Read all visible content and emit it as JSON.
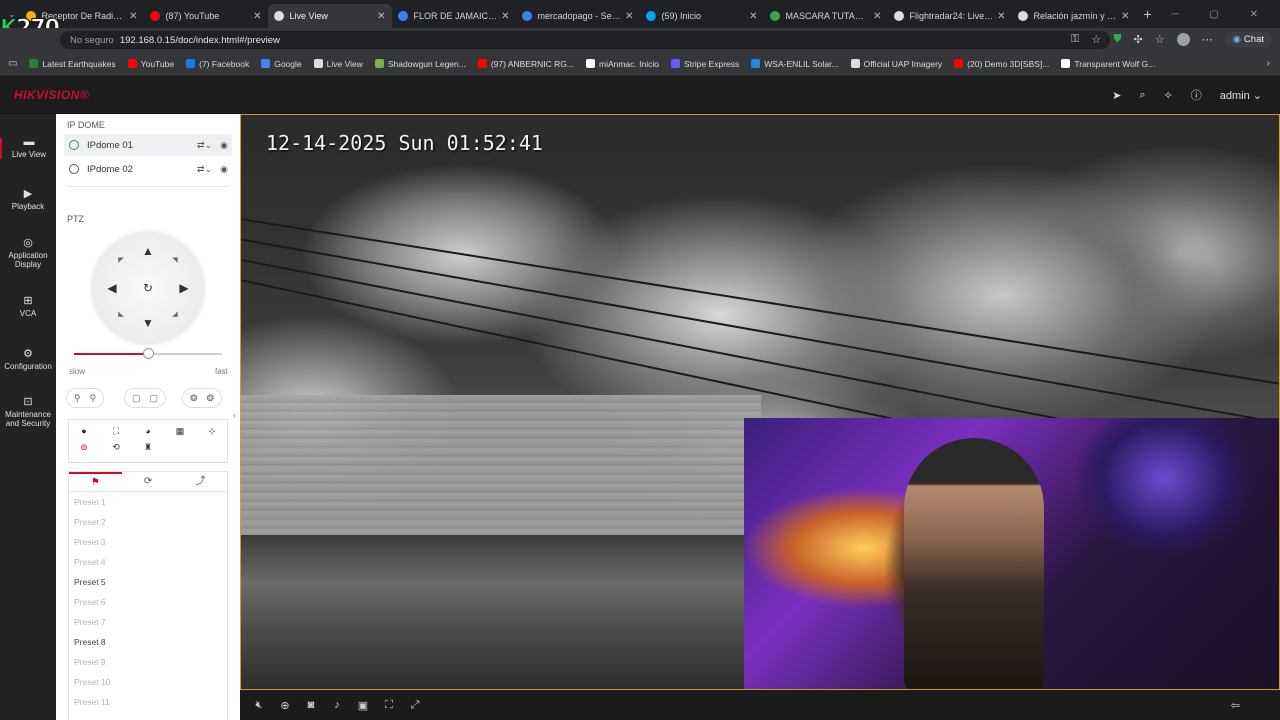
{
  "browser": {
    "tabs": [
      {
        "title": "Receptor De Radio Si47",
        "color": "#e6b800"
      },
      {
        "title": "(87) YouTube",
        "color": "#ff0000"
      },
      {
        "title": "Live View",
        "color": "#dddddd",
        "active": true
      },
      {
        "title": "FLOR DE JAMAICA - Sea",
        "color": "#3b82f6"
      },
      {
        "title": "mercadopago - Search",
        "color": "#3b82f6"
      },
      {
        "title": "(59) Inicio",
        "color": "#00a2ff"
      },
      {
        "title": "MASCARA TUTANKAMO",
        "color": "#34a853"
      },
      {
        "title": "Flightradar24: Live Fligh",
        "color": "#dddddd"
      },
      {
        "title": "Relación jazmín y muer",
        "color": "#dddddd"
      }
    ],
    "address": {
      "security": "No seguro",
      "url": "192.168.0.15/doc/index.html#/preview"
    },
    "chat_label": "Chat",
    "overlay_badge": {
      "prefix": "K",
      "number": "270"
    },
    "bookmarks": [
      {
        "label": "Latest Earthquakes",
        "color": "#2e7d32"
      },
      {
        "label": "YouTube",
        "color": "#ff0000"
      },
      {
        "label": "(7) Facebook",
        "color": "#1877f2"
      },
      {
        "label": "Google",
        "color": "#4285f4"
      },
      {
        "label": "Live View",
        "color": "#dddddd"
      },
      {
        "label": "Shadowgun Legen...",
        "color": "#7cb342"
      },
      {
        "label": "(97) ANBERNIC RG...",
        "color": "#ff0000"
      },
      {
        "label": "miAnmac. Inicio",
        "color": "#ffffff"
      },
      {
        "label": "Stripe Express",
        "color": "#635bff"
      },
      {
        "label": "WSA-ENLIL Solar...",
        "color": "#1e88e5"
      },
      {
        "label": "Official UAP Imagery",
        "color": "#dddddd"
      },
      {
        "label": "(20) Demo 3D[SBS]...",
        "color": "#ff0000"
      },
      {
        "label": "Transparent Wolf G...",
        "color": "#ffffff"
      }
    ]
  },
  "app": {
    "logo": "HIKVISION®",
    "user": "admin",
    "nav": [
      {
        "label": "Live View",
        "icon": "live-view-icon",
        "active": true
      },
      {
        "label": "Playback",
        "icon": "playback-icon"
      },
      {
        "label": "Application Display",
        "icon": "application-display-icon"
      },
      {
        "label": "VCA",
        "icon": "vca-icon"
      },
      {
        "label": "Configuration",
        "icon": "configuration-icon"
      },
      {
        "label": "Maintenance and Security",
        "icon": "maintenance-icon"
      }
    ],
    "panel": {
      "group_title": "IP DOME",
      "cameras": [
        "IPdome 01",
        "IPdome 02"
      ],
      "ptz_title": "PTZ",
      "speed": {
        "min_label": "slow",
        "max_label": "fast",
        "value_fraction": 0.5
      },
      "presets": [
        {
          "label": "Preset 1",
          "set": false
        },
        {
          "label": "Preset 2",
          "set": false
        },
        {
          "label": "Preset 3",
          "set": false
        },
        {
          "label": "Preset 4",
          "set": false
        },
        {
          "label": "Preset 5",
          "set": true
        },
        {
          "label": "Preset 6",
          "set": false
        },
        {
          "label": "Preset 7",
          "set": false
        },
        {
          "label": "Preset 8",
          "set": true
        },
        {
          "label": "Preset 9",
          "set": false
        },
        {
          "label": "Preset 10",
          "set": false
        },
        {
          "label": "Preset 11",
          "set": false
        }
      ]
    },
    "video": {
      "osd_timestamp": "12-14-2025 Sun 01:52:41"
    }
  }
}
